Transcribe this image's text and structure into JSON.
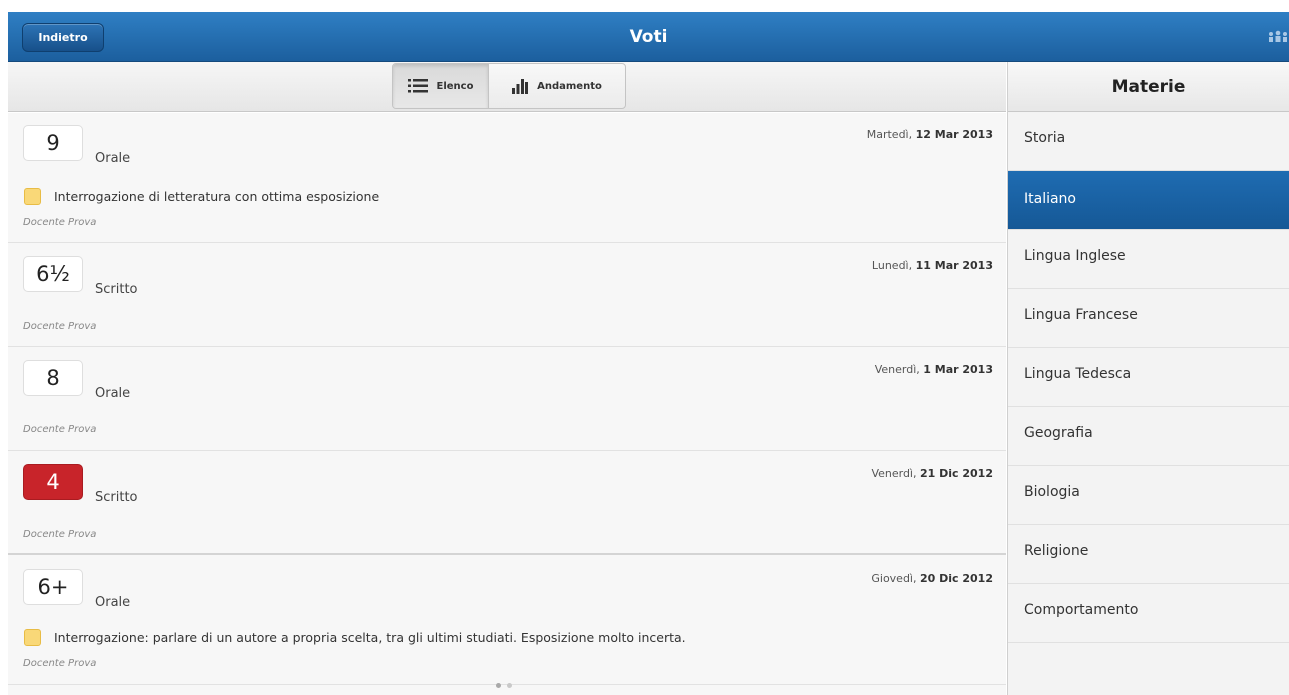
{
  "header": {
    "back_label": "Indietro",
    "title": "Voti",
    "people_icon": "people-icon"
  },
  "tabs": [
    {
      "label": "Elenco",
      "icon": "list-icon",
      "active": true
    },
    {
      "label": "Andamento",
      "icon": "bar-chart-icon",
      "active": false
    }
  ],
  "entries": [
    {
      "grade": "9",
      "type": "Orale",
      "day": "Martedì,",
      "date": "12 Mar 2013",
      "note": "Interrogazione di letteratura con ottima esposizione",
      "teacher": "Docente Prova",
      "insufficient": false
    },
    {
      "grade": "6½",
      "type": "Scritto",
      "day": "Lunedì,",
      "date": "11 Mar 2013",
      "note": "",
      "teacher": "Docente Prova",
      "insufficient": false
    },
    {
      "grade": "8",
      "type": "Orale",
      "day": "Venerdì,",
      "date": "1 Mar 2013",
      "note": "",
      "teacher": "Docente Prova",
      "insufficient": false
    },
    {
      "grade": "4",
      "type": "Scritto",
      "day": "Venerdì,",
      "date": "21 Dic 2012",
      "note": "",
      "teacher": "Docente Prova",
      "insufficient": true
    },
    {
      "grade": "6+",
      "type": "Orale",
      "day": "Giovedì,",
      "date": "20 Dic 2012",
      "note": "Interrogazione: parlare di un autore a propria scelta, tra gli ultimi studiati. Esposizione molto incerta.",
      "teacher": "Docente Prova",
      "insufficient": false
    }
  ],
  "sidebar": {
    "title": "Materie",
    "items": [
      {
        "label": "Storia"
      },
      {
        "label": "Italiano",
        "selected": true
      },
      {
        "label": "Lingua Inglese"
      },
      {
        "label": "Lingua Francese"
      },
      {
        "label": "Lingua Tedesca"
      },
      {
        "label": "Geografia"
      },
      {
        "label": "Biologia"
      },
      {
        "label": "Religione"
      },
      {
        "label": "Comportamento"
      }
    ]
  },
  "colors": {
    "header": "#1c5f9e",
    "selected": "#1f6cb2",
    "insufficient_grade": "#c8242a",
    "note": "#f9d878"
  }
}
